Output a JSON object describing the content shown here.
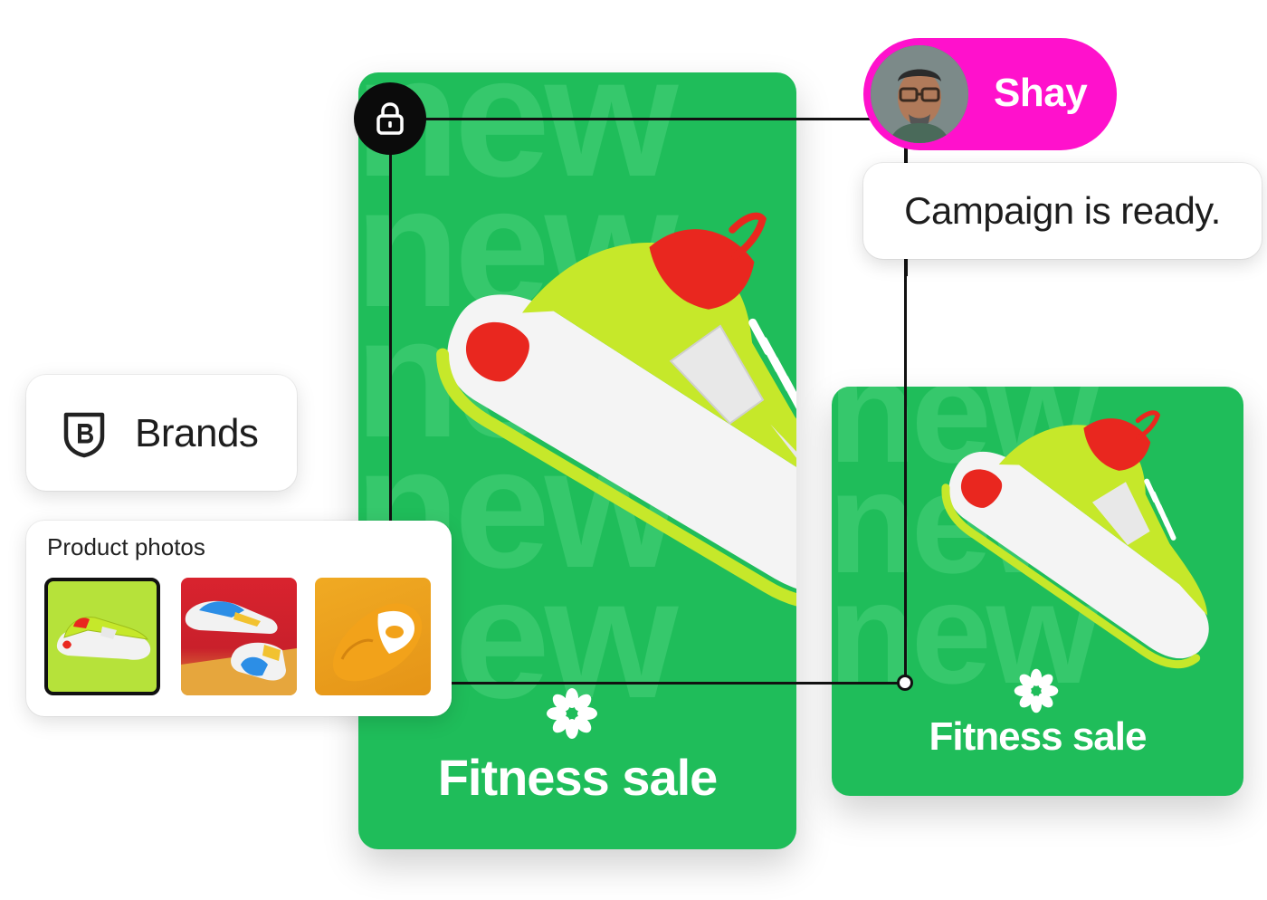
{
  "collaborator": {
    "name": "Shay",
    "avatar": "avatar-photo"
  },
  "comment": {
    "text": "Campaign is ready."
  },
  "brands_panel": {
    "label": "Brands",
    "icon": "brand-shield-icon"
  },
  "photos_panel": {
    "title": "Product photos",
    "thumbnails": [
      {
        "name": "lime-sneaker",
        "selected": true
      },
      {
        "name": "multicolor-sneakers",
        "selected": false
      },
      {
        "name": "orange-sneaker",
        "selected": false
      }
    ]
  },
  "ad_large": {
    "background_word": "new",
    "title": "Fitness sale"
  },
  "ad_small": {
    "background_word": "new",
    "title": "Fitness sale"
  },
  "colors": {
    "ad_green": "#1fbd5a",
    "pill_magenta": "#ff11cc",
    "shoe_lime": "#c6e82a",
    "shoe_red": "#e9271f"
  }
}
